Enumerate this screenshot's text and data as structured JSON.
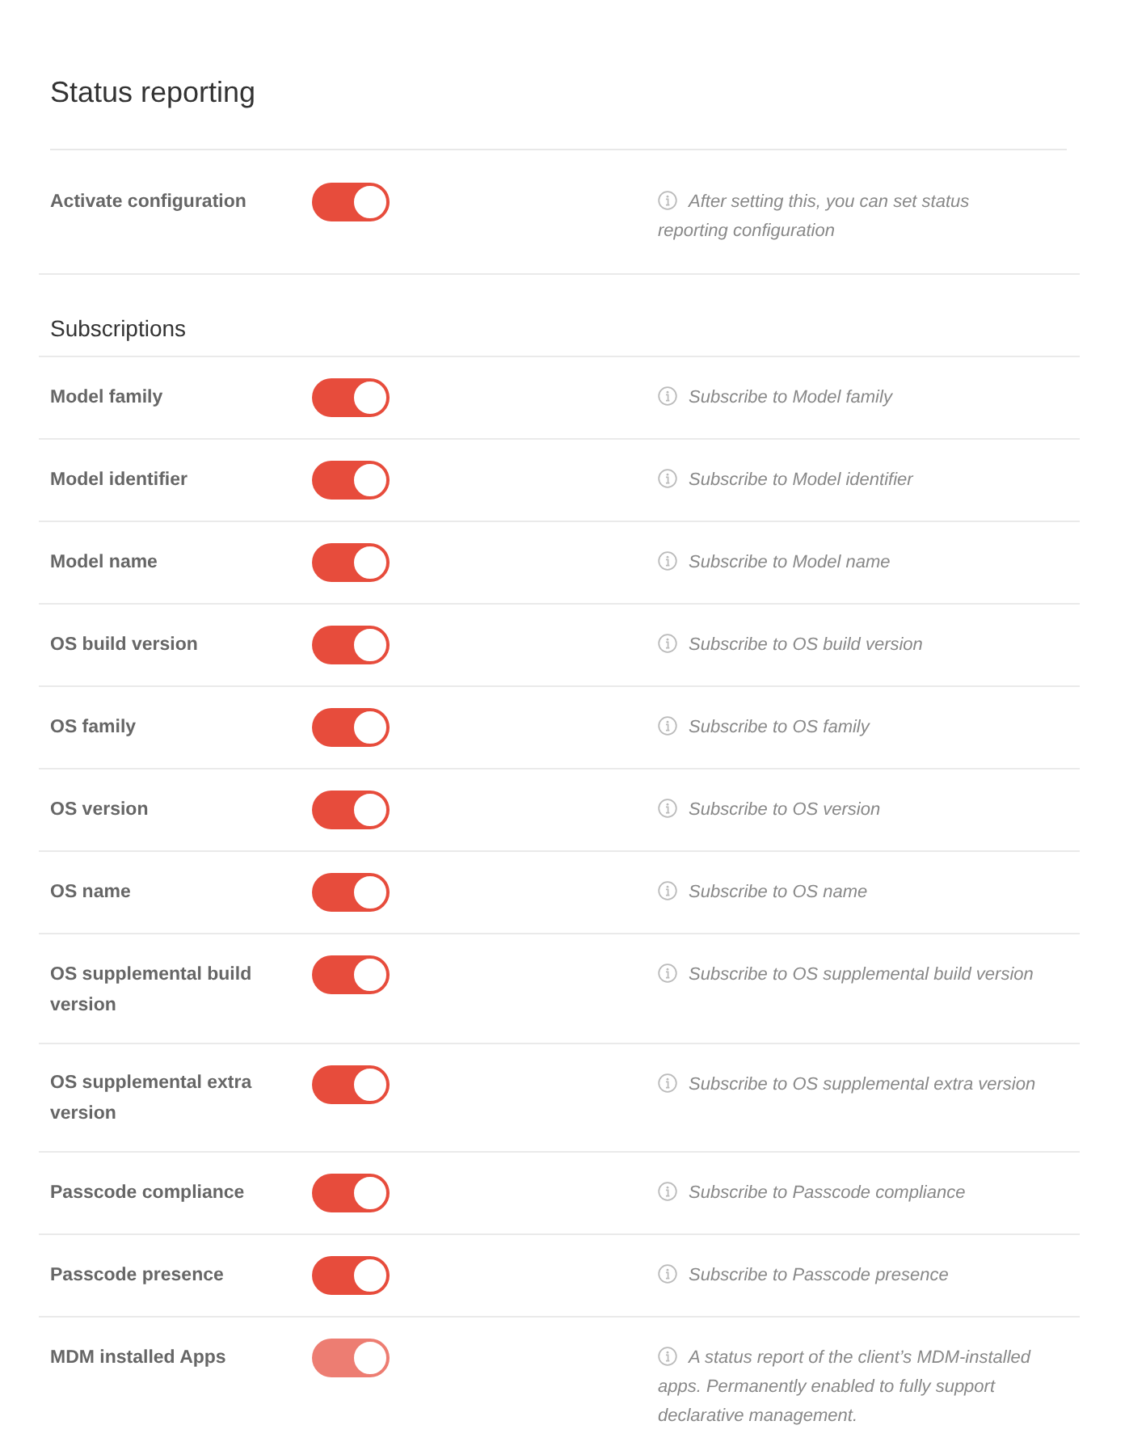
{
  "title": "Status reporting",
  "activate": {
    "label": "Activate configuration",
    "on": true,
    "disabled": false,
    "help": "After setting this, you can set status reporting configuration"
  },
  "subscriptions": {
    "heading": "Subscriptions",
    "items": [
      {
        "label": "Model family",
        "on": true,
        "disabled": false,
        "help": "Subscribe to Model family"
      },
      {
        "label": "Model identifier",
        "on": true,
        "disabled": false,
        "help": "Subscribe to Model identifier"
      },
      {
        "label": "Model name",
        "on": true,
        "disabled": false,
        "help": "Subscribe to Model name"
      },
      {
        "label": "OS build version",
        "on": true,
        "disabled": false,
        "help": "Subscribe to OS build version"
      },
      {
        "label": "OS family",
        "on": true,
        "disabled": false,
        "help": "Subscribe to OS family"
      },
      {
        "label": "OS version",
        "on": true,
        "disabled": false,
        "help": "Subscribe to OS version"
      },
      {
        "label": "OS name",
        "on": true,
        "disabled": false,
        "help": "Subscribe to OS name"
      },
      {
        "label": "OS supplemental build version",
        "on": true,
        "disabled": false,
        "help": "Subscribe to OS supplemental build version"
      },
      {
        "label": "OS supplemental extra version",
        "on": true,
        "disabled": false,
        "help": "Subscribe to OS supplemental extra version"
      },
      {
        "label": "Passcode compliance",
        "on": true,
        "disabled": false,
        "help": "Subscribe to Passcode compliance"
      },
      {
        "label": "Passcode presence",
        "on": true,
        "disabled": false,
        "help": "Subscribe to Passcode presence"
      },
      {
        "label": "MDM installed Apps",
        "on": true,
        "disabled": true,
        "help": "A status report of the client’s MDM-installed apps. Permanently enabled to fully support declarative management."
      }
    ]
  }
}
